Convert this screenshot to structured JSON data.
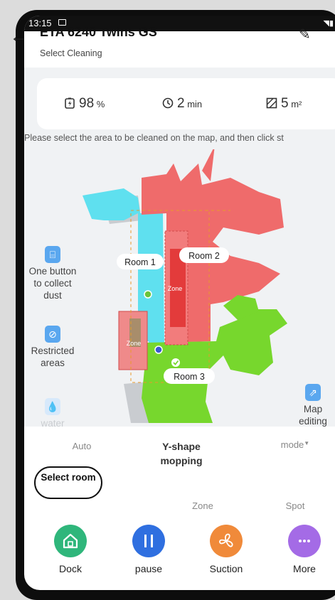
{
  "status_bar": {
    "time": "13:15"
  },
  "header": {
    "title": "ETA 6240 Twins GS",
    "subtitle": "Select Cleaning"
  },
  "stats": {
    "battery": {
      "value": "98",
      "unit": "%"
    },
    "time": {
      "value": "2",
      "unit": "min"
    },
    "area": {
      "value": "5",
      "unit": "m²"
    }
  },
  "hint": "Please select the area to be cleaned on the map, and then click st",
  "map": {
    "rooms": [
      "Room 1",
      "Room 2",
      "Room 3"
    ],
    "zones": [
      "Zone",
      "Zone"
    ]
  },
  "side_tools": {
    "collect_dust": "One button to collect dust",
    "restricted": "Restricted areas",
    "water": "water",
    "map_editing": "Map editing"
  },
  "modes": {
    "auto": "Auto",
    "y_shape": "Y-shape mopping",
    "mode": "mode",
    "select_room": "Select room",
    "zone": "Zone",
    "spot": "Spot"
  },
  "actions": {
    "dock": "Dock",
    "pause": "pause",
    "suction": "Suction",
    "more": "More"
  },
  "colors": {
    "room1": "#5fe0ef",
    "room2": "#ef6b6b",
    "room3": "#77d72d",
    "dock": "#2fb67b",
    "pause": "#2f6fe0",
    "suction": "#f08a3a",
    "more": "#a46be6",
    "tool_icon": "#5aa7ef"
  }
}
